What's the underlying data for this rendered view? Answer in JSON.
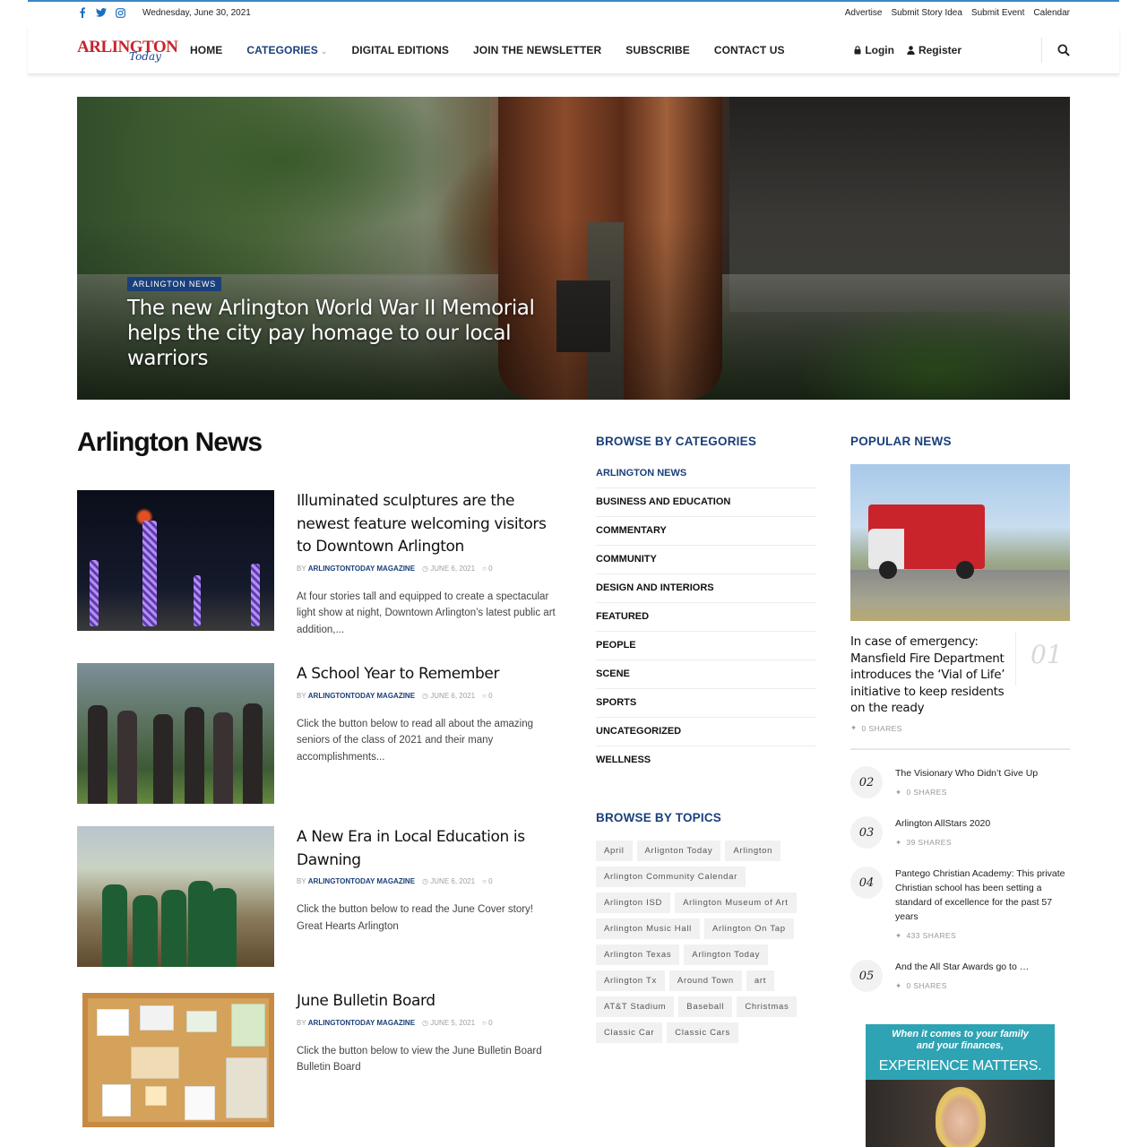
{
  "topbar": {
    "date": "Wednesday, June 30, 2021",
    "social": [
      "facebook-icon",
      "twitter-icon",
      "instagram-icon"
    ],
    "links": [
      "Advertise",
      "Submit Story Idea",
      "Submit Event",
      "Calendar"
    ]
  },
  "brand": {
    "logo_main": "ARLINGTON",
    "logo_script": "Today"
  },
  "nav": {
    "items": [
      "HOME",
      "CATEGORIES",
      "DIGITAL EDITIONS",
      "JOIN THE NEWSLETTER",
      "SUBSCRIBE",
      "CONTACT US"
    ],
    "active": "CATEGORIES",
    "login": "Login",
    "register": "Register"
  },
  "hero": {
    "category": "ARLINGTON NEWS",
    "title": "The new Arlington World War II Memorial helps the city pay homage to our local warriors"
  },
  "main": {
    "section_title": "Arlington News",
    "articles": [
      {
        "title": "Illuminated sculptures are the newest feature welcoming visitors to Downtown Arlington",
        "by": "BY",
        "author": "ARLINGTONTODAY MAGAZINE",
        "date": "JUNE 6, 2021",
        "comments": "0",
        "excerpt": "At four stories tall and equipped to create a spectacular light show at night, Downtown Arlington’s latest public art addition,..."
      },
      {
        "title": "A School Year to Remember",
        "by": "BY",
        "author": "ARLINGTONTODAY MAGAZINE",
        "date": "JUNE 6, 2021",
        "comments": "0",
        "excerpt": "Click the button below to read all about the amazing seniors of the class of 2021 and their many accomplishments..."
      },
      {
        "title": "A New Era in Local Education is Dawning",
        "by": "BY",
        "author": "ARLINGTONTODAY MAGAZINE",
        "date": "JUNE 6, 2021",
        "comments": "0",
        "excerpt": "Click the button below to read the June Cover story! Great Hearts Arlington"
      },
      {
        "title": "June Bulletin Board",
        "by": "BY",
        "author": "ARLINGTONTODAY MAGAZINE",
        "date": "JUNE 5, 2021",
        "comments": "0",
        "excerpt": "Click the button below to view the June Bulletin Board Bulletin Board"
      }
    ]
  },
  "categories": {
    "title": "BROWSE BY CATEGORIES",
    "items": [
      "ARLINGTON NEWS",
      "BUSINESS AND EDUCATION",
      "COMMENTARY",
      "COMMUNITY",
      "DESIGN AND INTERIORS",
      "FEATURED",
      "PEOPLE",
      "SCENE",
      "SPORTS",
      "UNCATEGORIZED",
      "WELLNESS"
    ]
  },
  "topics": {
    "title": "BROWSE BY TOPICS",
    "tags": [
      "April",
      "Arlignton Today",
      "Arlington",
      "Arlington Community Calendar",
      "Arlington ISD",
      "Arlington Museum of Art",
      "Arlington Music Hall",
      "Arlington On Tap",
      "Arlington Texas",
      "Arlington Today",
      "Arlington Tx",
      "Around Town",
      "art",
      "AT&T Stadium",
      "Baseball",
      "Christmas",
      "Classic Car",
      "Classic Cars"
    ]
  },
  "popular": {
    "title": "POPULAR NEWS",
    "first": {
      "num": "01",
      "title": "In case of emergency: Mansfield Fire Department introduces the ‘Vial of Life’ initiative to keep residents on the ready",
      "shares": "0 SHARES"
    },
    "items": [
      {
        "num": "02",
        "title": "The Visionary Who Didn’t Give Up",
        "shares": "0 SHARES"
      },
      {
        "num": "03",
        "title": "Arlington AllStars 2020",
        "shares": "39 SHARES"
      },
      {
        "num": "04",
        "title": "Pantego Christian Academy: This private Christian school has been setting a standard of excellence for the past 57 years",
        "shares": "433 SHARES"
      },
      {
        "num": "05",
        "title": "And the All Star Awards go to …",
        "shares": "0 SHARES"
      }
    ]
  },
  "ad": {
    "line1": "When it comes to your family",
    "line1b": "and your finances,",
    "line2": "EXPERIENCE MATTERS."
  },
  "colors": {
    "brand_navy": "#1a3f7a",
    "logo_red": "#c8242b",
    "ad_teal": "#2ea3b4"
  }
}
